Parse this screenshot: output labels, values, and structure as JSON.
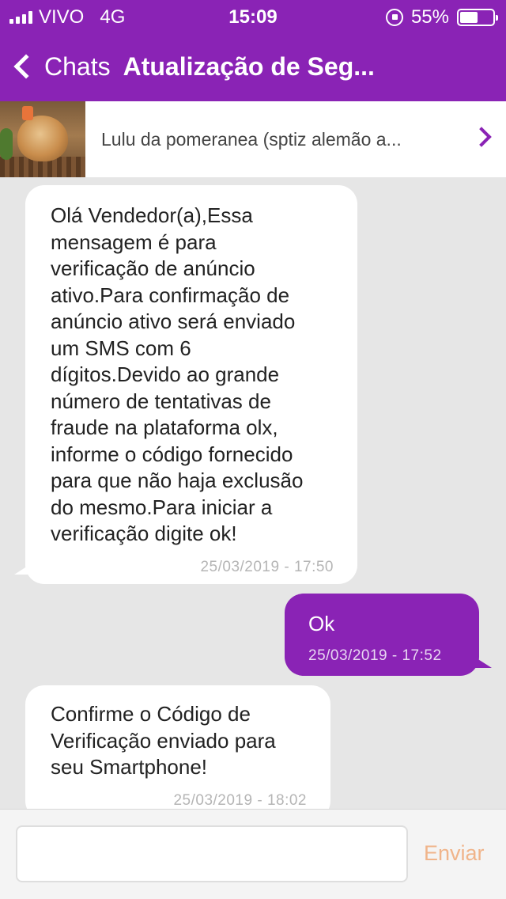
{
  "status_bar": {
    "carrier": "VIVO",
    "network": "4G",
    "time": "15:09",
    "battery": "55%",
    "battery_level": 0.55
  },
  "nav": {
    "back_label": "Chats",
    "title": "Atualização de Seg..."
  },
  "listing": {
    "title": "Lulu da pomeranea (sptiz alemão a..."
  },
  "messages": [
    {
      "direction": "in",
      "text": "Olá Vendedor(a),Essa\nmensagem é para\nverificação de anúncio\nativo.Para confirmação de\nanúncio ativo será enviado\num SMS com 6\ndígitos.Devido ao grande\nnúmero de tentativas de\nfraude na plataforma olx,\ninforme o código fornecido\npara que não haja exclusão\ndo mesmo.Para iniciar a\nverificação digite ok!",
      "timestamp": "25/03/2019 - 17:50"
    },
    {
      "direction": "out",
      "text": "Ok",
      "timestamp": "25/03/2019 - 17:52"
    },
    {
      "direction": "in",
      "text": "Confirme o Código de\nVerificação enviado para\nseu Smartphone!",
      "timestamp": "25/03/2019 - 18:02"
    }
  ],
  "composer": {
    "placeholder": "",
    "send_label": "Enviar"
  },
  "colors": {
    "brand_purple": "#8a23b5",
    "send_disabled": "#f0b48a",
    "chat_background": "#e6e6e6"
  }
}
